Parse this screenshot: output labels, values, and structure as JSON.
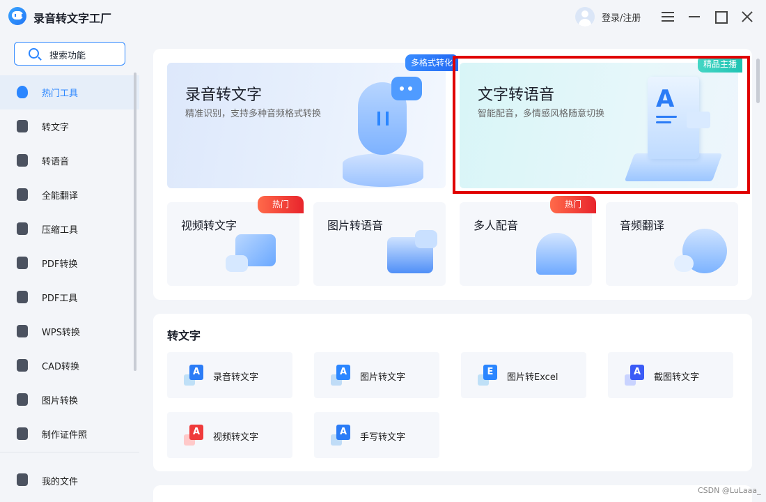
{
  "app": {
    "title": "录音转文字工厂",
    "login_label": "登录/注册"
  },
  "sidebar": {
    "search_label": "搜索功能",
    "items": [
      {
        "label": "热门工具",
        "icon": "flame-icon",
        "active": true
      },
      {
        "label": "转文字",
        "icon": "text-convert-icon"
      },
      {
        "label": "转语音",
        "icon": "voice-icon"
      },
      {
        "label": "全能翻译",
        "icon": "translate-icon"
      },
      {
        "label": "压缩工具",
        "icon": "compress-icon"
      },
      {
        "label": "PDF转换",
        "icon": "pdf-convert-icon"
      },
      {
        "label": "PDF工具",
        "icon": "briefcase-icon"
      },
      {
        "label": "WPS转换",
        "icon": "wps-icon"
      },
      {
        "label": "CAD转换",
        "icon": "cad-icon"
      },
      {
        "label": "图片转换",
        "icon": "image-icon"
      },
      {
        "label": "制作证件照",
        "icon": "id-photo-icon"
      }
    ],
    "my_files": "我的文件"
  },
  "featured": [
    {
      "title": "录音转文字",
      "subtitle": "精准识别，支持多种音频格式转换",
      "badge": "多格式转化"
    },
    {
      "title": "文字转语音",
      "subtitle": "智能配音，多情感风格随意切换",
      "badge": "精品主播"
    }
  ],
  "quick_tools": [
    {
      "title": "视频转文字",
      "hot": true
    },
    {
      "title": "图片转语音",
      "hot": false
    },
    {
      "title": "多人配音",
      "hot": true
    },
    {
      "title": "音频翻译",
      "hot": false
    }
  ],
  "hot_label": "热门",
  "section": {
    "title": "转文字",
    "tools": [
      {
        "label": "录音转文字",
        "glyph": "A",
        "color": "#2b7cf6"
      },
      {
        "label": "图片转文字",
        "glyph": "A",
        "color": "#2b86ff"
      },
      {
        "label": "图片转Excel",
        "glyph": "E",
        "color": "#2b86ff"
      },
      {
        "label": "截图转文字",
        "glyph": "A",
        "color": "#3b5bf6"
      },
      {
        "label": "视频转文字",
        "glyph": "A",
        "color": "#ef3b3b"
      },
      {
        "label": "手写转文字",
        "glyph": "A",
        "color": "#2b7cf6"
      }
    ]
  },
  "watermark": "CSDN @LuLaaa_",
  "colors": {
    "accent": "#2b86ff",
    "highlight": "#e00000",
    "hot": "#e8242c"
  }
}
